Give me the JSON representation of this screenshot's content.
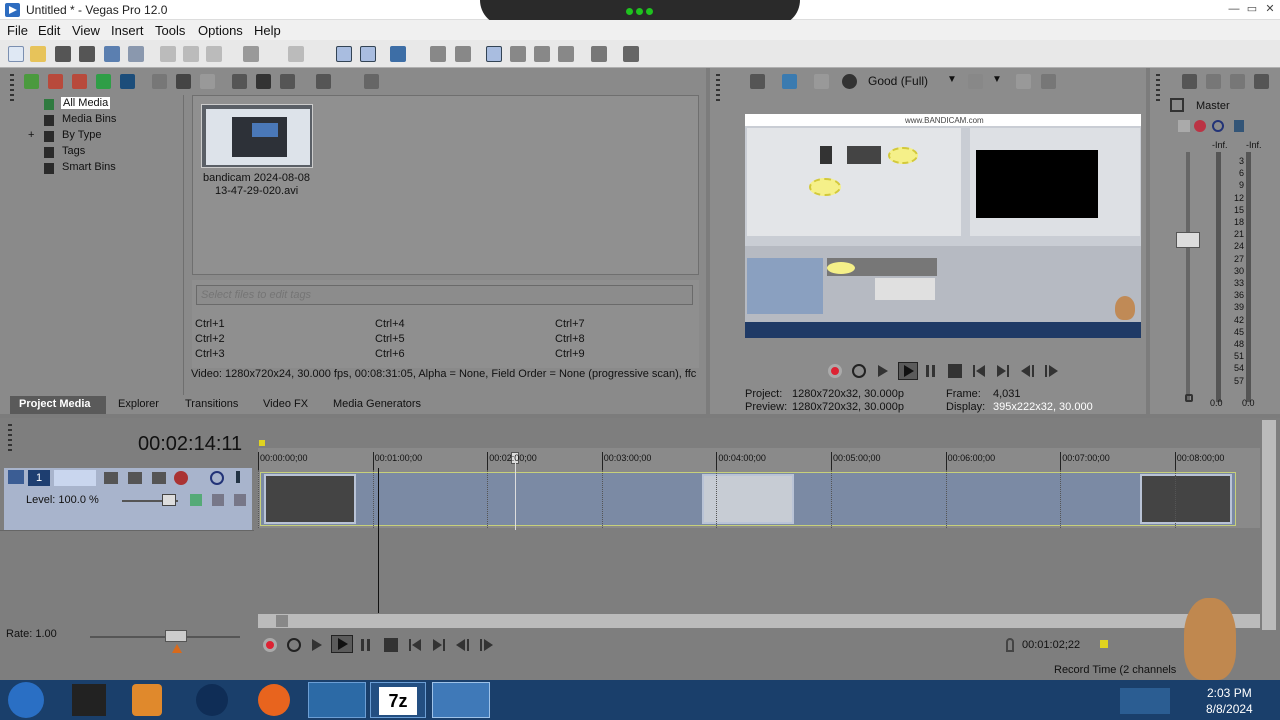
{
  "window": {
    "title": "Untitled * - Vegas Pro 12.0"
  },
  "menu": [
    "File",
    "Edit",
    "View",
    "Insert",
    "Tools",
    "Options",
    "Help"
  ],
  "media_tree": {
    "items": [
      "All Media",
      "Media Bins",
      "By Type",
      "Tags",
      "Smart Bins"
    ],
    "expander": "+"
  },
  "media_file": {
    "line1": "bandicam 2024-08-08",
    "line2": "13-47-29-020.avi"
  },
  "tags": {
    "placeholder": "Select files to edit tags",
    "shortcuts": [
      "Ctrl+1",
      "Ctrl+4",
      "Ctrl+7",
      "Ctrl+2",
      "Ctrl+5",
      "Ctrl+8",
      "Ctrl+3",
      "Ctrl+6",
      "Ctrl+9"
    ]
  },
  "media_info": "Video: 1280x720x24, 30.000 fps, 00:08:31:05, Alpha = None, Field Order = None (progressive scan), ffc",
  "tabs": [
    "Project Media",
    "Explorer",
    "Transitions",
    "Video FX",
    "Media Generators"
  ],
  "preview": {
    "quality": "Good (Full)",
    "project_label": "Project:",
    "project_value": "1280x720x32, 30.000p",
    "preview_label": "Preview:",
    "preview_value": "1280x720x32, 30.000p",
    "frame_label": "Frame:",
    "frame_value": "4,031",
    "display_label": "Display:",
    "display_value": "395x222x32, 30.000",
    "screen_text": "www.BANDICAM.com"
  },
  "master": {
    "title": "Master",
    "inf_left": "-Inf.",
    "inf_right": "-Inf.",
    "scale": [
      "3",
      "6",
      "9",
      "12",
      "15",
      "18",
      "21",
      "24",
      "27",
      "30",
      "33",
      "36",
      "39",
      "42",
      "45",
      "48",
      "51",
      "54",
      "57"
    ],
    "bottom_left": "0.0",
    "bottom_right": "0.0"
  },
  "timeline": {
    "current_time": "00:02:14:11",
    "track_number": "1",
    "level": "Level: 100.0 %",
    "ruler": [
      "00:00:00;00",
      "00:01:00;00",
      "00:02:00;00",
      "00:03:00;00",
      "00:04:00;00",
      "00:05:00;00",
      "00:06:00;00",
      "00:07:00;00",
      "00:08:00;00"
    ],
    "rate": "Rate: 1.00",
    "cursor_time": "00:01:02;22",
    "record_time": "Record Time (2 channels"
  },
  "taskbar": {
    "time": "2:03 PM",
    "date": "8/8/2024",
    "zip_label": "7z"
  },
  "colors": {
    "panel": "#8a8a8a",
    "toolbar": "#e8e8e8",
    "clip": "#7b8aa4",
    "clip_border": "#c7d07a",
    "taskbar": "#1a3f6b"
  }
}
